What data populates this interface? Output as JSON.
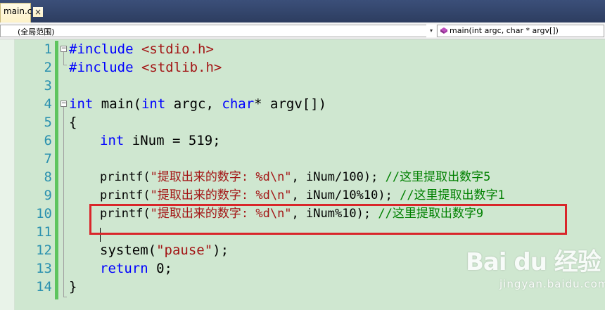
{
  "tab": {
    "label": "main.c",
    "close": "×"
  },
  "navbar": {
    "scope_value": "(全局范围)",
    "function_value": "main(int argc, char * argv[])"
  },
  "lines": [
    {
      "n": "1"
    },
    {
      "n": "2"
    },
    {
      "n": "3"
    },
    {
      "n": "4"
    },
    {
      "n": "5"
    },
    {
      "n": "6"
    },
    {
      "n": "7"
    },
    {
      "n": "8"
    },
    {
      "n": "9"
    },
    {
      "n": "10"
    },
    {
      "n": "11"
    },
    {
      "n": "12"
    },
    {
      "n": "13"
    },
    {
      "n": "14"
    }
  ],
  "code": {
    "l1_directive": "#include",
    "l1_header": " <stdio.h>",
    "l2_directive": "#include",
    "l2_header": " <stdlib.h>",
    "l4_kw1": "int",
    "l4_a": " main(",
    "l4_kw2": "int",
    "l4_b": " argc, ",
    "l4_kw3": "char",
    "l4_c": "* argv[])",
    "l5": "{",
    "l6_kw": "int",
    "l6_rest": " iNum = 519;",
    "l8_fn": "printf(",
    "l8_str": "\"提取出来的数字: %d\\n\"",
    "l8_rest": ", iNum/100); ",
    "l8_cmt": "//这里提取出数字5",
    "l9_fn": "printf(",
    "l9_str": "\"提取出来的数字: %d\\n\"",
    "l9_rest": ", iNum/10%10); ",
    "l9_cmt": "//这里提取出数字1",
    "l10_fn": "printf(",
    "l10_str": "\"提取出来的数字: %d\\n\"",
    "l10_rest": ", iNum%10); ",
    "l10_cmt": "//这里提取出数字9",
    "l12_fn": "system(",
    "l12_str": "\"pause\"",
    "l12_rest": ");",
    "l13_kw": "return",
    "l13_rest": " 0;",
    "l14": "}"
  },
  "watermark": {
    "logo": "Bai du 经验",
    "sub": "jingyan.baidu.com"
  },
  "colors": {
    "editor_bg": "#cfe7d0",
    "keyword": "#0000ff",
    "string": "#a31515",
    "comment": "#008000",
    "line_number": "#2b91af",
    "highlight_box": "#d9262a",
    "change_bar": "#5ec45e"
  }
}
